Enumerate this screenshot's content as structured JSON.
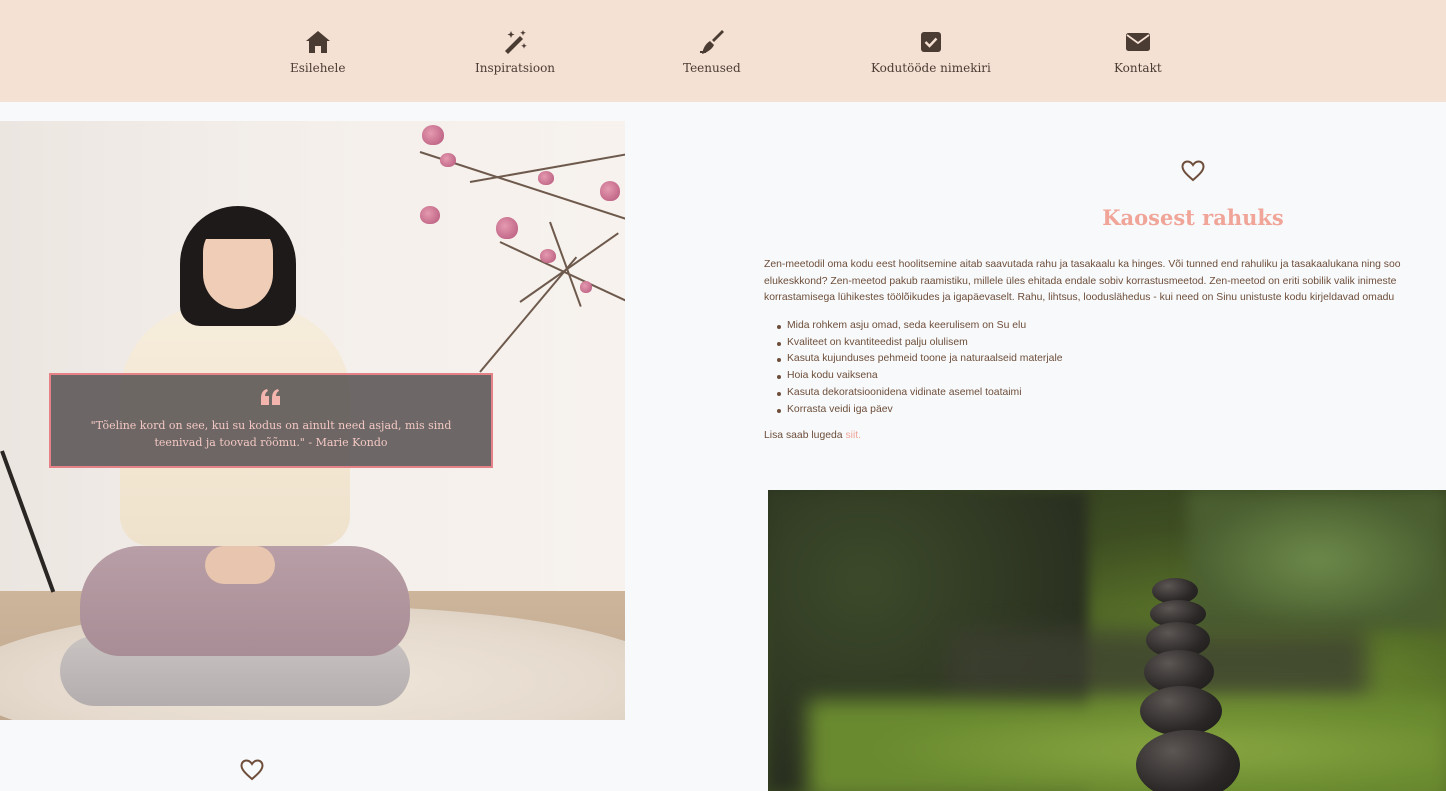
{
  "nav": {
    "items": [
      {
        "label": "Esilehele",
        "icon": "home-icon"
      },
      {
        "label": "Inspiratsioon",
        "icon": "magic-wand-icon"
      },
      {
        "label": "Teenused",
        "icon": "broom-icon"
      },
      {
        "label": "Kodutööde nimekiri",
        "icon": "checkbox-icon"
      },
      {
        "label": "Kontakt",
        "icon": "envelope-icon"
      }
    ]
  },
  "quote": {
    "text": "\"Tõeline kord on see, kui su kodus on ainult need asjad, mis sind teenivad ja toovad rõõmu.\" - Marie Kondo"
  },
  "section": {
    "title": "Kaosest rahuks",
    "intro_lines": [
      "Zen-meetodil oma kodu eest hoolitsemine aitab saavutada rahu ja tasakaalu ka hinges. Või tunned end rahuliku ja tasakaalukana ning soo",
      "elukeskkond? Zen-meetod pakub raamistiku, millele üles ehitada endale sobiv korrastusmeetod. Zen-meetod on eriti sobilik valik inimeste",
      "korrastamisega lühikestes töölõikudes ja igapäevaselt. Rahu, lihtsus, looduslähedus - kui need on Sinu unistuste kodu kirjeldavad omadu"
    ],
    "bullets": [
      "Mida rohkem asju omad, seda keerulisem on Su elu",
      "Kvaliteet on kvantiteedist palju olulisem",
      "Kasuta kujunduses pehmeid toone ja naturaalseid materjale",
      "Hoia kodu vaiksena",
      "Kasuta dekoratsioonidena vidinate asemel toataimi",
      "Korrasta veidi iga päev"
    ],
    "read_more_prefix": "Lisa saab lugeda ",
    "read_more_link": "siit."
  },
  "colors": {
    "nav_bg": "#f5e1d3",
    "accent": "#f0a598",
    "text": "#6e4e3a",
    "quote_border": "#e48288"
  }
}
